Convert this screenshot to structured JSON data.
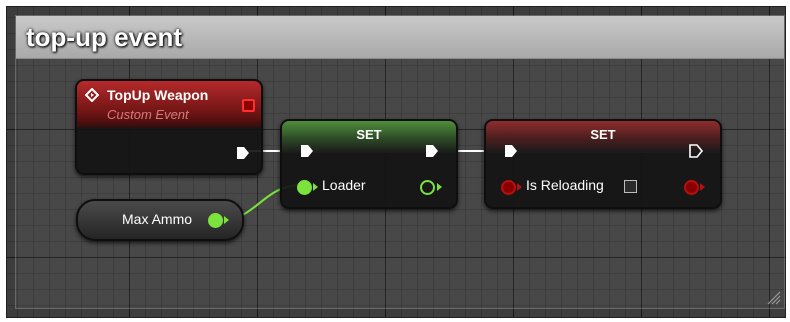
{
  "comment": {
    "title": "top-up event"
  },
  "event_node": {
    "title": "TopUp Weapon",
    "subtitle": "Custom Event",
    "header_color": "#8b1a1a",
    "icon": "diamond-event-icon"
  },
  "set_loader": {
    "title": "SET",
    "pin_label": "Loader",
    "pin_color": "#7be33c"
  },
  "set_reloading": {
    "title": "SET",
    "pin_label": "Is Reloading",
    "pin_color": "#b81010",
    "checked": false
  },
  "max_ammo": {
    "label": "Max Ammo",
    "pin_color": "#7be33c"
  },
  "colors": {
    "exec_wire": "#ffffff",
    "int_wire": "#7be33c",
    "graph_bg": "#3d3d3d"
  }
}
